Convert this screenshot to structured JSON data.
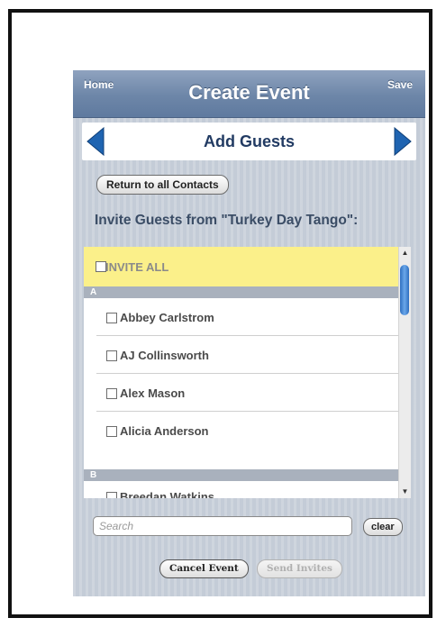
{
  "navbar": {
    "title": "Create Event",
    "left_button": "Home",
    "right_button": "Save"
  },
  "subheader": {
    "title": "Add Guests",
    "left_icon": "arrow-left-icon",
    "right_icon": "arrow-right-icon"
  },
  "return_button": "Return to all Contacts",
  "invite_heading": "Invite Guests from \"Turkey Day Tango\":",
  "list": {
    "invite_all_label": "INVITE ALL",
    "sections": [
      {
        "header": "A",
        "contacts": [
          "Abbey Carlstrom",
          "AJ Collinsworth",
          "Alex Mason",
          "Alicia Anderson"
        ]
      },
      {
        "header": "B",
        "contacts": [
          "Breedan Watkins"
        ]
      }
    ]
  },
  "search": {
    "placeholder": "Search",
    "value": "",
    "clear_label": "clear"
  },
  "footer": {
    "cancel_label": "Cancel Event",
    "send_label": "Send Invites"
  },
  "colors": {
    "navbar": "#6d86a8",
    "invite_all_bg": "#fbf08a",
    "section_header": "#a9b1bd",
    "title_text": "#223b63",
    "arrow": "#1f64b1"
  }
}
